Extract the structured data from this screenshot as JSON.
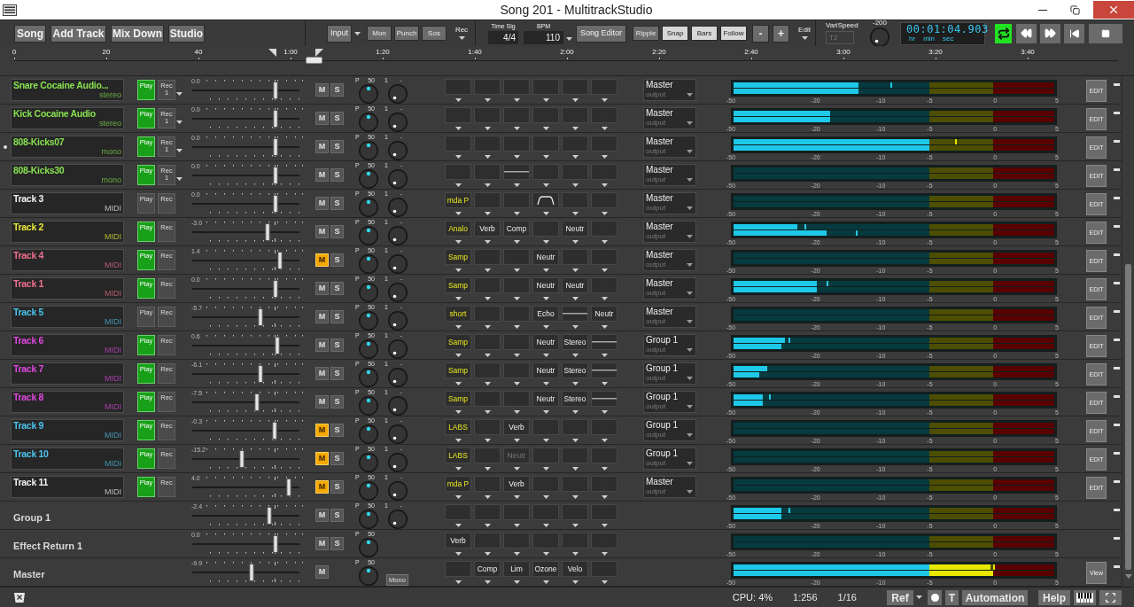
{
  "window": {
    "title": "Song 201 - MultitrackStudio"
  },
  "toolbar": {
    "main_buttons": [
      "Song",
      "Add Track",
      "Mix Down",
      "Studio"
    ],
    "input": "Input",
    "modes": [
      {
        "label": "Mon",
        "on": false
      },
      {
        "label": "Punch",
        "on": false
      },
      {
        "label": "Sos",
        "on": false
      }
    ],
    "rec": "Rec",
    "time_sig": {
      "label": "Time Sig",
      "value": "4/4"
    },
    "bpm": {
      "label": "BPM",
      "value": "110"
    },
    "song_editor": "Song Editor",
    "toggles": [
      {
        "label": "Ripple",
        "on": false
      },
      {
        "label": "Snap",
        "on": true
      },
      {
        "label": "Bars",
        "on": true
      },
      {
        "label": "Follow",
        "on": true
      }
    ],
    "zoom_buttons": [
      "-",
      "+"
    ],
    "edit": "Edit",
    "varispeed": {
      "label": "VariSpeed",
      "value": "T2",
      "disabled": true
    },
    "knob_value": "-200",
    "time": {
      "value": "00:01:04.903",
      "units": [
        "hr",
        "min",
        "sec"
      ]
    },
    "transport": [
      {
        "kind": "loop",
        "on": true
      },
      {
        "kind": "rewind",
        "on": false
      },
      {
        "kind": "forward",
        "on": false
      },
      {
        "kind": "start",
        "on": false
      },
      {
        "kind": "stop",
        "on": false
      }
    ]
  },
  "ruler": {
    "labels": [
      "0",
      "20",
      "40",
      "1:00",
      "1:20",
      "1:40",
      "2:00",
      "2:20",
      "2:40",
      "3:00",
      "3:20",
      "3:40"
    ]
  },
  "tracks": [
    {
      "kind": "audio",
      "name": "Snare Cocaine Audio...",
      "color": "#86e04f",
      "type": "stereo",
      "selected": false,
      "play": {
        "label": "Play",
        "on": true
      },
      "rec": {
        "label": "Rec",
        "channel": "1"
      },
      "fader": {
        "value": "0.0",
        "level": 0.78
      },
      "mute": {
        "label": "M",
        "on": false
      },
      "solo": {
        "label": "S"
      },
      "pan": {
        "label": "P",
        "value": "50"
      },
      "volume": {
        "label": "1",
        "value": "-"
      },
      "fx": [
        {
          "kind": "empty"
        },
        {
          "kind": "empty"
        },
        {
          "kind": "empty"
        },
        {
          "kind": "empty"
        },
        {
          "kind": "empty"
        },
        {
          "kind": "empty"
        }
      ],
      "output": {
        "name": "Master",
        "label": "output"
      },
      "meter": {
        "channels": [
          {
            "level": 0.39,
            "peak": {
              "level": 0.49
            }
          },
          {
            "level": 0.39
          }
        ],
        "scale": [
          "-50",
          "-20",
          "-10",
          "-5",
          "0",
          "5"
        ]
      },
      "edit": "EDIT"
    },
    {
      "kind": "audio",
      "name": "Kick Cocaine Audio",
      "color": "#86e04f",
      "type": "stereo",
      "selected": false,
      "play": {
        "label": "Play",
        "on": true
      },
      "rec": {
        "label": "Rec",
        "channel": "1"
      },
      "fader": {
        "value": "0.0",
        "level": 0.78
      },
      "mute": {
        "label": "M",
        "on": false
      },
      "solo": {
        "label": "S"
      },
      "pan": {
        "label": "P",
        "value": "50"
      },
      "volume": {
        "label": "1",
        "value": "-"
      },
      "fx": [
        {
          "kind": "empty"
        },
        {
          "kind": "empty"
        },
        {
          "kind": "empty"
        },
        {
          "kind": "empty"
        },
        {
          "kind": "empty"
        },
        {
          "kind": "empty"
        }
      ],
      "output": {
        "name": "Master",
        "label": "output"
      },
      "meter": {
        "channels": [
          {
            "level": 0.3
          },
          {
            "level": 0.3
          }
        ],
        "scale": [
          "-50",
          "-20",
          "-10",
          "-5",
          "0",
          "5"
        ]
      },
      "edit": "EDIT"
    },
    {
      "kind": "audio",
      "name": "808-Kicks07",
      "color": "#86e04f",
      "type": "mono",
      "selected": true,
      "play": {
        "label": "Play",
        "on": true
      },
      "rec": {
        "label": "Rec",
        "channel": "1"
      },
      "fader": {
        "value": "0.0",
        "level": 0.78
      },
      "mute": {
        "label": "M",
        "on": false
      },
      "solo": {
        "label": "S"
      },
      "pan": {
        "label": "P",
        "value": "50"
      },
      "volume": {
        "label": "1",
        "value": "-"
      },
      "fx": [
        {
          "kind": "empty"
        },
        {
          "kind": "empty"
        },
        {
          "kind": "empty"
        },
        {
          "kind": "empty"
        },
        {
          "kind": "empty"
        },
        {
          "kind": "empty"
        }
      ],
      "output": {
        "name": "Master",
        "label": "output"
      },
      "meter": {
        "channels": [
          {
            "level": 0.61,
            "peak": {
              "level": 0.69
            }
          },
          {
            "level": 0.61
          }
        ],
        "scale": [
          "-50",
          "-20",
          "-10",
          "-5",
          "0",
          "5"
        ]
      },
      "edit": "EDIT"
    },
    {
      "kind": "audio",
      "name": "808-Kicks30",
      "color": "#86e04f",
      "type": "mono",
      "selected": false,
      "play": {
        "label": "Play",
        "on": true
      },
      "rec": {
        "label": "Rec",
        "channel": "1"
      },
      "fader": {
        "value": "0.0",
        "level": 0.78
      },
      "mute": {
        "label": "M",
        "on": false
      },
      "solo": {
        "label": "S"
      },
      "pan": {
        "label": "P",
        "value": "50"
      },
      "volume": {
        "label": "1",
        "value": "-"
      },
      "fx": [
        {
          "kind": "empty"
        },
        {
          "kind": "empty"
        },
        {
          "kind": "line"
        },
        {
          "kind": "empty"
        },
        {
          "kind": "empty"
        },
        {
          "kind": "empty"
        }
      ],
      "output": {
        "name": "Master",
        "label": "output"
      },
      "meter": {
        "channels": [
          {
            "level": 0
          },
          {
            "level": 0
          }
        ],
        "scale": [
          "-50",
          "-20",
          "-10",
          "-5",
          "0",
          "5"
        ]
      },
      "edit": "EDIT"
    },
    {
      "kind": "midi",
      "name": "Track 3",
      "color": "#f2f2f2",
      "type": "MIDI",
      "selected": false,
      "play": {
        "label": "Play",
        "on": false
      },
      "rec": {
        "label": "Rec"
      },
      "fader": {
        "value": "0.0",
        "level": 0.78
      },
      "mute": {
        "label": "M",
        "on": false
      },
      "solo": {
        "label": "S"
      },
      "pan": {
        "label": "P",
        "value": "50"
      },
      "volume": {
        "label": "1",
        "value": "-"
      },
      "fx": [
        {
          "kind": "instrument",
          "label": "mda P"
        },
        {
          "kind": "empty"
        },
        {
          "kind": "empty"
        },
        {
          "kind": "curve"
        },
        {
          "kind": "empty"
        },
        {
          "kind": "empty"
        }
      ],
      "output": {
        "name": "Master",
        "label": "output"
      },
      "meter": {
        "channels": [
          {
            "level": 0
          },
          {
            "level": 0
          }
        ],
        "scale": [
          "-50",
          "-20",
          "-10",
          "-5",
          "0",
          "5"
        ]
      },
      "edit": "EDIT"
    },
    {
      "kind": "midi",
      "name": "Track 2",
      "color": "#e8e83a",
      "type": "MIDI",
      "selected": false,
      "play": {
        "label": "Play",
        "on": true
      },
      "rec": {
        "label": "Rec"
      },
      "fader": {
        "value": "-3.0",
        "level": 0.7
      },
      "mute": {
        "label": "M",
        "on": false
      },
      "solo": {
        "label": "S"
      },
      "pan": {
        "label": "P",
        "value": "50"
      },
      "volume": {
        "label": "1",
        "value": "-"
      },
      "fx": [
        {
          "kind": "instrument",
          "label": "Analo"
        },
        {
          "kind": "effect",
          "label": "Verb"
        },
        {
          "kind": "effect",
          "label": "Comp"
        },
        {
          "kind": "empty"
        },
        {
          "kind": "effect",
          "label": "Neutr"
        },
        {
          "kind": "empty"
        }
      ],
      "output": {
        "name": "Master",
        "label": "output"
      },
      "meter": {
        "channels": [
          {
            "level": 0.2,
            "peak": {
              "level": 0.22
            }
          },
          {
            "level": 0.29,
            "peak": {
              "level": 0.38
            }
          }
        ],
        "scale": [
          "-50",
          "-20",
          "-10",
          "-5",
          "0",
          "5"
        ]
      },
      "edit": "EDIT"
    },
    {
      "kind": "midi",
      "name": "Track 4",
      "color": "#f07090",
      "type": "MIDI",
      "selected": false,
      "play": {
        "label": "Play",
        "on": true
      },
      "rec": {
        "label": "Rec"
      },
      "fader": {
        "value": "1.4",
        "level": 0.82
      },
      "mute": {
        "label": "M",
        "on": true
      },
      "solo": {
        "label": "S"
      },
      "pan": {
        "label": "P",
        "value": "50"
      },
      "volume": {
        "label": "1",
        "value": "-"
      },
      "fx": [
        {
          "kind": "instrument",
          "label": "Samp"
        },
        {
          "kind": "empty"
        },
        {
          "kind": "empty"
        },
        {
          "kind": "effect",
          "label": "Neutr"
        },
        {
          "kind": "empty"
        },
        {
          "kind": "empty"
        }
      ],
      "output": {
        "name": "Master",
        "label": "output"
      },
      "meter": {
        "channels": [
          {
            "level": 0
          },
          {
            "level": 0
          }
        ],
        "scale": [
          "-50",
          "-20",
          "-10",
          "-5",
          "0",
          "5"
        ]
      },
      "edit": "EDIT"
    },
    {
      "kind": "midi",
      "name": "Track 1",
      "color": "#f07090",
      "type": "MIDI",
      "selected": false,
      "play": {
        "label": "Play",
        "on": true
      },
      "rec": {
        "label": "Rec"
      },
      "fader": {
        "value": "0.0",
        "level": 0.78
      },
      "mute": {
        "label": "M",
        "on": false
      },
      "solo": {
        "label": "S"
      },
      "pan": {
        "label": "P",
        "value": "50"
      },
      "volume": {
        "label": "1",
        "value": "-"
      },
      "fx": [
        {
          "kind": "instrument",
          "label": "Samp"
        },
        {
          "kind": "empty"
        },
        {
          "kind": "empty"
        },
        {
          "kind": "effect",
          "label": "Neutr"
        },
        {
          "kind": "effect",
          "label": "Neutr"
        },
        {
          "kind": "empty"
        }
      ],
      "output": {
        "name": "Master",
        "label": "output"
      },
      "meter": {
        "channels": [
          {
            "level": 0.26,
            "peak": {
              "level": 0.29
            }
          },
          {
            "level": 0.26
          }
        ],
        "scale": [
          "-50",
          "-20",
          "-10",
          "-5",
          "0",
          "5"
        ]
      },
      "edit": "EDIT"
    },
    {
      "kind": "midi",
      "name": "Track 5",
      "color": "#4cc4ee",
      "type": "MIDI",
      "selected": false,
      "play": {
        "label": "Play",
        "on": false
      },
      "rec": {
        "label": "Rec"
      },
      "fader": {
        "value": "-5.7",
        "level": 0.64
      },
      "mute": {
        "label": "M",
        "on": false
      },
      "solo": {
        "label": "S"
      },
      "pan": {
        "label": "P",
        "value": "50"
      },
      "volume": {
        "label": "1",
        "value": "-"
      },
      "fx": [
        {
          "kind": "instrument",
          "label": "short"
        },
        {
          "kind": "empty"
        },
        {
          "kind": "empty"
        },
        {
          "kind": "effect",
          "label": "Echo"
        },
        {
          "kind": "line"
        },
        {
          "kind": "effect",
          "label": "Neutr"
        }
      ],
      "output": {
        "name": "Master",
        "label": "output"
      },
      "meter": {
        "channels": [
          {
            "level": 0
          },
          {
            "level": 0
          }
        ],
        "scale": [
          "-50",
          "-20",
          "-10",
          "-5",
          "0",
          "5"
        ]
      },
      "edit": "EDIT"
    },
    {
      "kind": "midi",
      "name": "Track 6",
      "color": "#e048e0",
      "type": "MIDI",
      "selected": false,
      "play": {
        "label": "Play",
        "on": true
      },
      "rec": {
        "label": "Rec"
      },
      "fader": {
        "value": "0.6",
        "level": 0.79
      },
      "mute": {
        "label": "M",
        "on": false
      },
      "solo": {
        "label": "S"
      },
      "pan": {
        "label": "P",
        "value": "50"
      },
      "volume": {
        "label": "1",
        "value": "-"
      },
      "fx": [
        {
          "kind": "instrument",
          "label": "Samp"
        },
        {
          "kind": "empty"
        },
        {
          "kind": "empty"
        },
        {
          "kind": "effect",
          "label": "Neutr"
        },
        {
          "kind": "effect",
          "label": "Stereo"
        },
        {
          "kind": "line"
        }
      ],
      "output": {
        "name": "Group 1",
        "label": "output"
      },
      "meter": {
        "channels": [
          {
            "level": 0.16,
            "peak": {
              "level": 0.17
            }
          },
          {
            "level": 0.15
          }
        ],
        "scale": [
          "-50",
          "-20",
          "-10",
          "-5",
          "0",
          "5"
        ]
      },
      "edit": "EDIT"
    },
    {
      "kind": "midi",
      "name": "Track 7",
      "color": "#e048e0",
      "type": "MIDI",
      "selected": false,
      "play": {
        "label": "Play",
        "on": true
      },
      "rec": {
        "label": "Rec"
      },
      "fader": {
        "value": "-6.1",
        "level": 0.64
      },
      "mute": {
        "label": "M",
        "on": false
      },
      "solo": {
        "label": "S"
      },
      "pan": {
        "label": "P",
        "value": "50"
      },
      "volume": {
        "label": "1",
        "value": "-"
      },
      "fx": [
        {
          "kind": "instrument",
          "label": "Samp"
        },
        {
          "kind": "empty"
        },
        {
          "kind": "empty"
        },
        {
          "kind": "effect",
          "label": "Neutr"
        },
        {
          "kind": "effect",
          "label": "Stereo"
        },
        {
          "kind": "line"
        }
      ],
      "output": {
        "name": "Group 1",
        "label": "output"
      },
      "meter": {
        "channels": [
          {
            "level": 0.1,
            "peak": {
              "level": 0.1
            }
          },
          {
            "level": 0.08
          }
        ],
        "scale": [
          "-50",
          "-20",
          "-10",
          "-5",
          "0",
          "5"
        ]
      },
      "edit": "EDIT"
    },
    {
      "kind": "midi",
      "name": "Track 8",
      "color": "#e048e0",
      "type": "MIDI",
      "selected": false,
      "play": {
        "label": "Play",
        "on": true
      },
      "rec": {
        "label": "Rec"
      },
      "fader": {
        "value": "-7.5",
        "level": 0.6
      },
      "mute": {
        "label": "M",
        "on": false
      },
      "solo": {
        "label": "S"
      },
      "pan": {
        "label": "P",
        "value": "50"
      },
      "volume": {
        "label": "1",
        "value": "-"
      },
      "fx": [
        {
          "kind": "instrument",
          "label": "Samp"
        },
        {
          "kind": "empty"
        },
        {
          "kind": "empty"
        },
        {
          "kind": "effect",
          "label": "Neutr"
        },
        {
          "kind": "effect",
          "label": "Stereo"
        },
        {
          "kind": "line"
        }
      ],
      "output": {
        "name": "Group 1",
        "label": "output"
      },
      "meter": {
        "channels": [
          {
            "level": 0.09,
            "peak": {
              "level": 0.11
            }
          },
          {
            "level": 0.09
          }
        ],
        "scale": [
          "-50",
          "-20",
          "-10",
          "-5",
          "0",
          "5"
        ]
      },
      "edit": "EDIT"
    },
    {
      "kind": "midi",
      "name": "Track 9",
      "color": "#4cc4ee",
      "type": "MIDI",
      "selected": false,
      "play": {
        "label": "Play",
        "on": true
      },
      "rec": {
        "label": "Rec"
      },
      "fader": {
        "value": "-0.3",
        "level": 0.77
      },
      "mute": {
        "label": "M",
        "on": true
      },
      "solo": {
        "label": "S"
      },
      "pan": {
        "label": "P",
        "value": "50"
      },
      "volume": {
        "label": "1",
        "value": "-"
      },
      "fx": [
        {
          "kind": "instrument",
          "label": "LABS"
        },
        {
          "kind": "empty"
        },
        {
          "kind": "effect",
          "label": "Verb"
        },
        {
          "kind": "empty"
        },
        {
          "kind": "empty"
        },
        {
          "kind": "empty"
        }
      ],
      "output": {
        "name": "Group 1",
        "label": "output"
      },
      "meter": {
        "channels": [
          {
            "level": 0
          },
          {
            "level": 0
          }
        ],
        "scale": [
          "-50",
          "-20",
          "-10",
          "-5",
          "0",
          "5"
        ]
      },
      "edit": "EDIT"
    },
    {
      "kind": "midi",
      "name": "Track 10",
      "color": "#4cc4ee",
      "type": "MIDI",
      "selected": false,
      "play": {
        "label": "Play",
        "on": true
      },
      "rec": {
        "label": "Rec"
      },
      "fader": {
        "value": "-15.2",
        "level": 0.46
      },
      "mute": {
        "label": "M",
        "on": true
      },
      "solo": {
        "label": "S"
      },
      "pan": {
        "label": "P",
        "value": "50"
      },
      "volume": {
        "label": "1",
        "value": "-"
      },
      "fx": [
        {
          "kind": "instrument",
          "label": "LABS"
        },
        {
          "kind": "empty"
        },
        {
          "kind": "disabled",
          "label": "Neutr"
        },
        {
          "kind": "empty"
        },
        {
          "kind": "empty"
        },
        {
          "kind": "empty"
        }
      ],
      "output": {
        "name": "Group 1",
        "label": "output"
      },
      "meter": {
        "channels": [
          {
            "level": 0
          },
          {
            "level": 0
          }
        ],
        "scale": [
          "-50",
          "-20",
          "-10",
          "-5",
          "0",
          "5"
        ]
      },
      "edit": "EDIT"
    },
    {
      "kind": "midi",
      "name": "Track 11",
      "color": "#f2f2f2",
      "type": "MIDI",
      "selected": false,
      "play": {
        "label": "Play",
        "on": true
      },
      "rec": {
        "label": "Rec"
      },
      "fader": {
        "value": "4.0",
        "level": 0.9
      },
      "mute": {
        "label": "M",
        "on": true
      },
      "solo": {
        "label": "S"
      },
      "pan": {
        "label": "P",
        "value": "50"
      },
      "volume": {
        "label": "1",
        "value": "-"
      },
      "fx": [
        {
          "kind": "instrument",
          "label": "mda P"
        },
        {
          "kind": "empty"
        },
        {
          "kind": "effect",
          "label": "Verb"
        },
        {
          "kind": "empty"
        },
        {
          "kind": "empty"
        },
        {
          "kind": "empty"
        }
      ],
      "output": {
        "name": "Master",
        "label": "output"
      },
      "meter": {
        "channels": [
          {
            "level": 0
          },
          {
            "level": 0
          }
        ],
        "scale": [
          "-50",
          "-20",
          "-10",
          "-5",
          "0",
          "5"
        ]
      },
      "edit": "EDIT"
    },
    {
      "kind": "bus",
      "name": "Group 1",
      "selected": false,
      "fader": {
        "value": "-2.4",
        "level": 0.72
      },
      "mute": {
        "label": "M",
        "on": false
      },
      "solo": {
        "label": "S"
      },
      "pan": {
        "label": "P",
        "value": "50"
      },
      "volume": {
        "label": "1",
        "value": "-"
      },
      "fx": [
        {
          "kind": "empty"
        },
        {
          "kind": "empty"
        },
        {
          "kind": "empty"
        },
        {
          "kind": "empty"
        },
        {
          "kind": "empty"
        },
        {
          "kind": "empty"
        }
      ],
      "meter": {
        "channels": [
          {
            "level": 0.15,
            "peak": {
              "level": 0.17
            }
          },
          {
            "level": 0.15
          }
        ],
        "scale": [
          "-50",
          "-20",
          "-10",
          "-5",
          "0",
          "5"
        ]
      }
    },
    {
      "kind": "bus",
      "name": "Effect Return 1",
      "selected": false,
      "fader": {
        "value": "0.0",
        "level": 0.78
      },
      "mute": {
        "label": "M",
        "on": false
      },
      "solo": {
        "label": "S"
      },
      "pan": {
        "label": "P",
        "value": "50"
      },
      "fx": [
        {
          "kind": "effect",
          "label": "Verb"
        },
        {
          "kind": "empty"
        },
        {
          "kind": "empty"
        },
        {
          "kind": "empty"
        },
        {
          "kind": "empty"
        },
        {
          "kind": "empty"
        }
      ],
      "meter": {
        "channels": [
          {
            "level": 0
          },
          {
            "level": 0
          }
        ],
        "scale": [
          "-50",
          "-20",
          "-10",
          "-5",
          "0",
          "5"
        ]
      }
    },
    {
      "kind": "master",
      "name": "Master",
      "selected": false,
      "fader": {
        "value": "-9.9",
        "level": 0.55
      },
      "mute": {
        "label": "M",
        "on": false
      },
      "pan": {
        "label": "P",
        "value": "50"
      },
      "mono": "Mono",
      "fx": [
        {
          "kind": "empty"
        },
        {
          "kind": "effect",
          "label": "Comp"
        },
        {
          "kind": "effect",
          "label": "Lim"
        },
        {
          "kind": "effect",
          "label": "Ozone"
        },
        {
          "kind": "effect",
          "label": "Velo"
        },
        {
          "kind": "empty"
        }
      ],
      "meter": {
        "channels": [
          {
            "level": 0.8,
            "peak": {
              "level": 0.81
            }
          },
          {
            "level": 0.81
          }
        ],
        "scale": [
          "-50",
          "-20",
          "-10",
          "-5",
          "0",
          "5"
        ]
      },
      "edit": "View"
    }
  ],
  "status_bar": {
    "readouts": [
      "CPU: 4%",
      "1:256",
      "1/16"
    ],
    "ref": "Ref",
    "t_button": "T",
    "automation": "Automation",
    "help": "Help"
  }
}
